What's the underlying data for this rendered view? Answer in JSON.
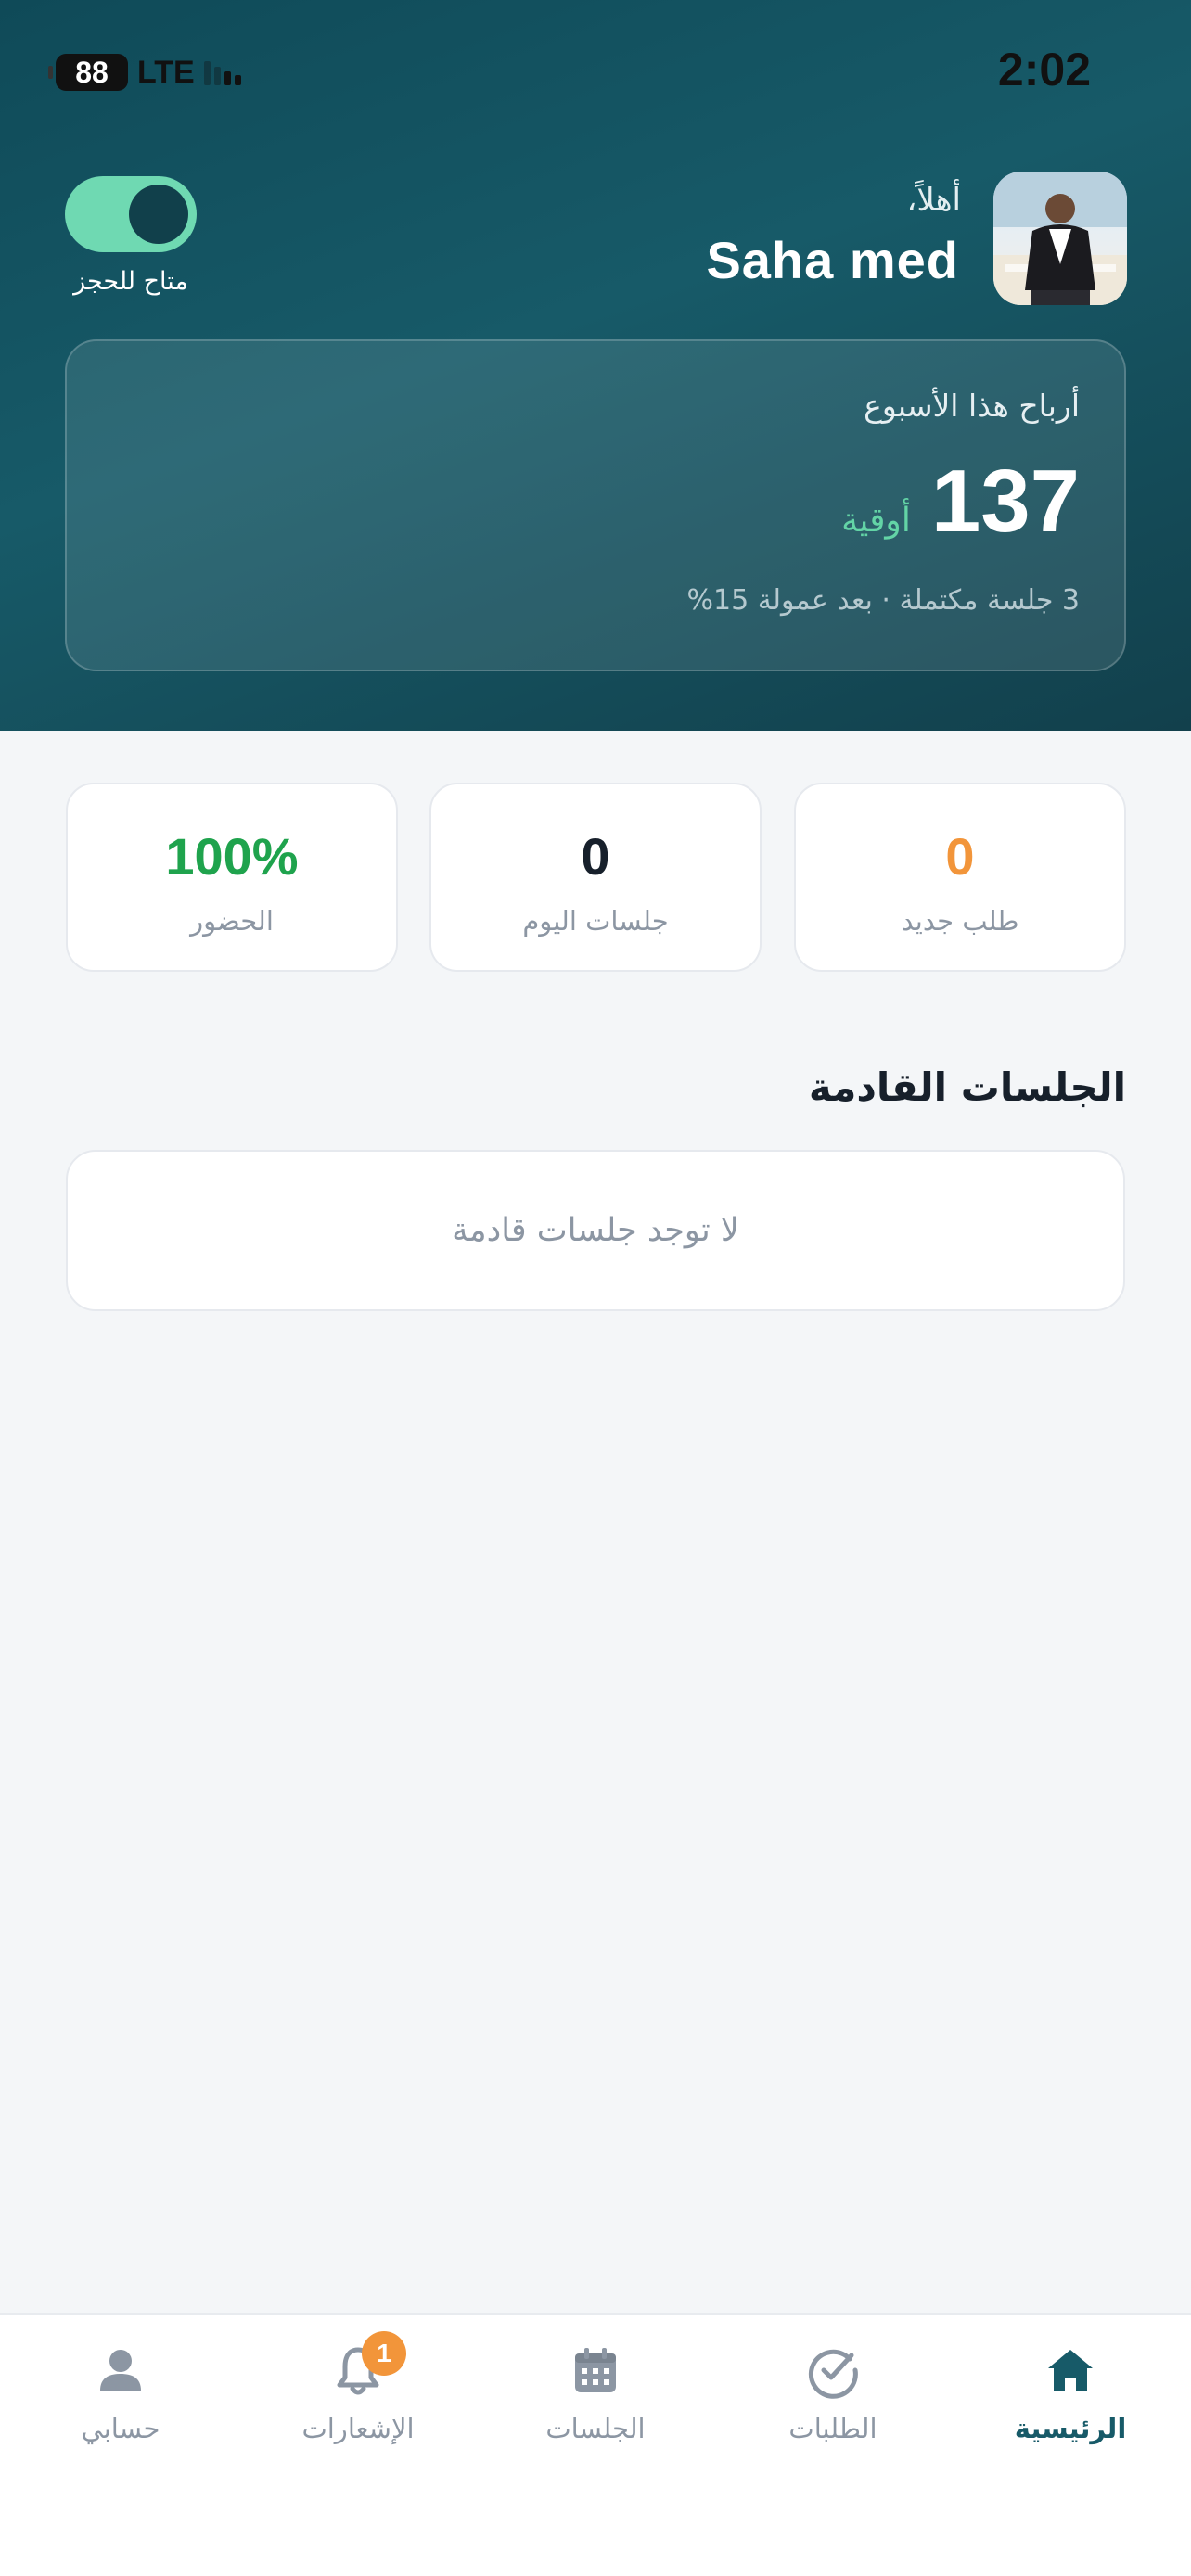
{
  "status_bar": {
    "battery": "88",
    "network": "LTE",
    "time": "2:02"
  },
  "header": {
    "greeting": "أهلاً،",
    "user_name": "Saha med",
    "availability_label": "متاح للحجز",
    "availability_on": true
  },
  "earnings": {
    "title": "أرباح هذا الأسبوع",
    "value": "137",
    "currency": "أوقية",
    "subtitle": "3 جلسة مكتملة · بعد عمولة 15%"
  },
  "stats": [
    {
      "value": "0",
      "label": "طلب جديد",
      "color": "#f2953a"
    },
    {
      "value": "0",
      "label": "جلسات اليوم",
      "color": "#17202b"
    },
    {
      "value": "100%",
      "label": "الحضور",
      "color": "#1fa34d"
    }
  ],
  "upcoming": {
    "title": "الجلسات القادمة",
    "empty_text": "لا توجد جلسات قادمة"
  },
  "nav": {
    "items": [
      {
        "label": "الرئيسية",
        "icon": "home-icon",
        "active": true
      },
      {
        "label": "الطلبات",
        "icon": "check-circle-icon",
        "active": false
      },
      {
        "label": "الجلسات",
        "icon": "calendar-icon",
        "active": false
      },
      {
        "label": "الإشعارات",
        "icon": "bell-icon",
        "active": false,
        "badge": "1"
      },
      {
        "label": "حسابي",
        "icon": "user-icon",
        "active": false
      }
    ]
  },
  "colors": {
    "brand": "#175a68",
    "accent_green": "#63d4a6",
    "badge_orange": "#f2953a"
  }
}
